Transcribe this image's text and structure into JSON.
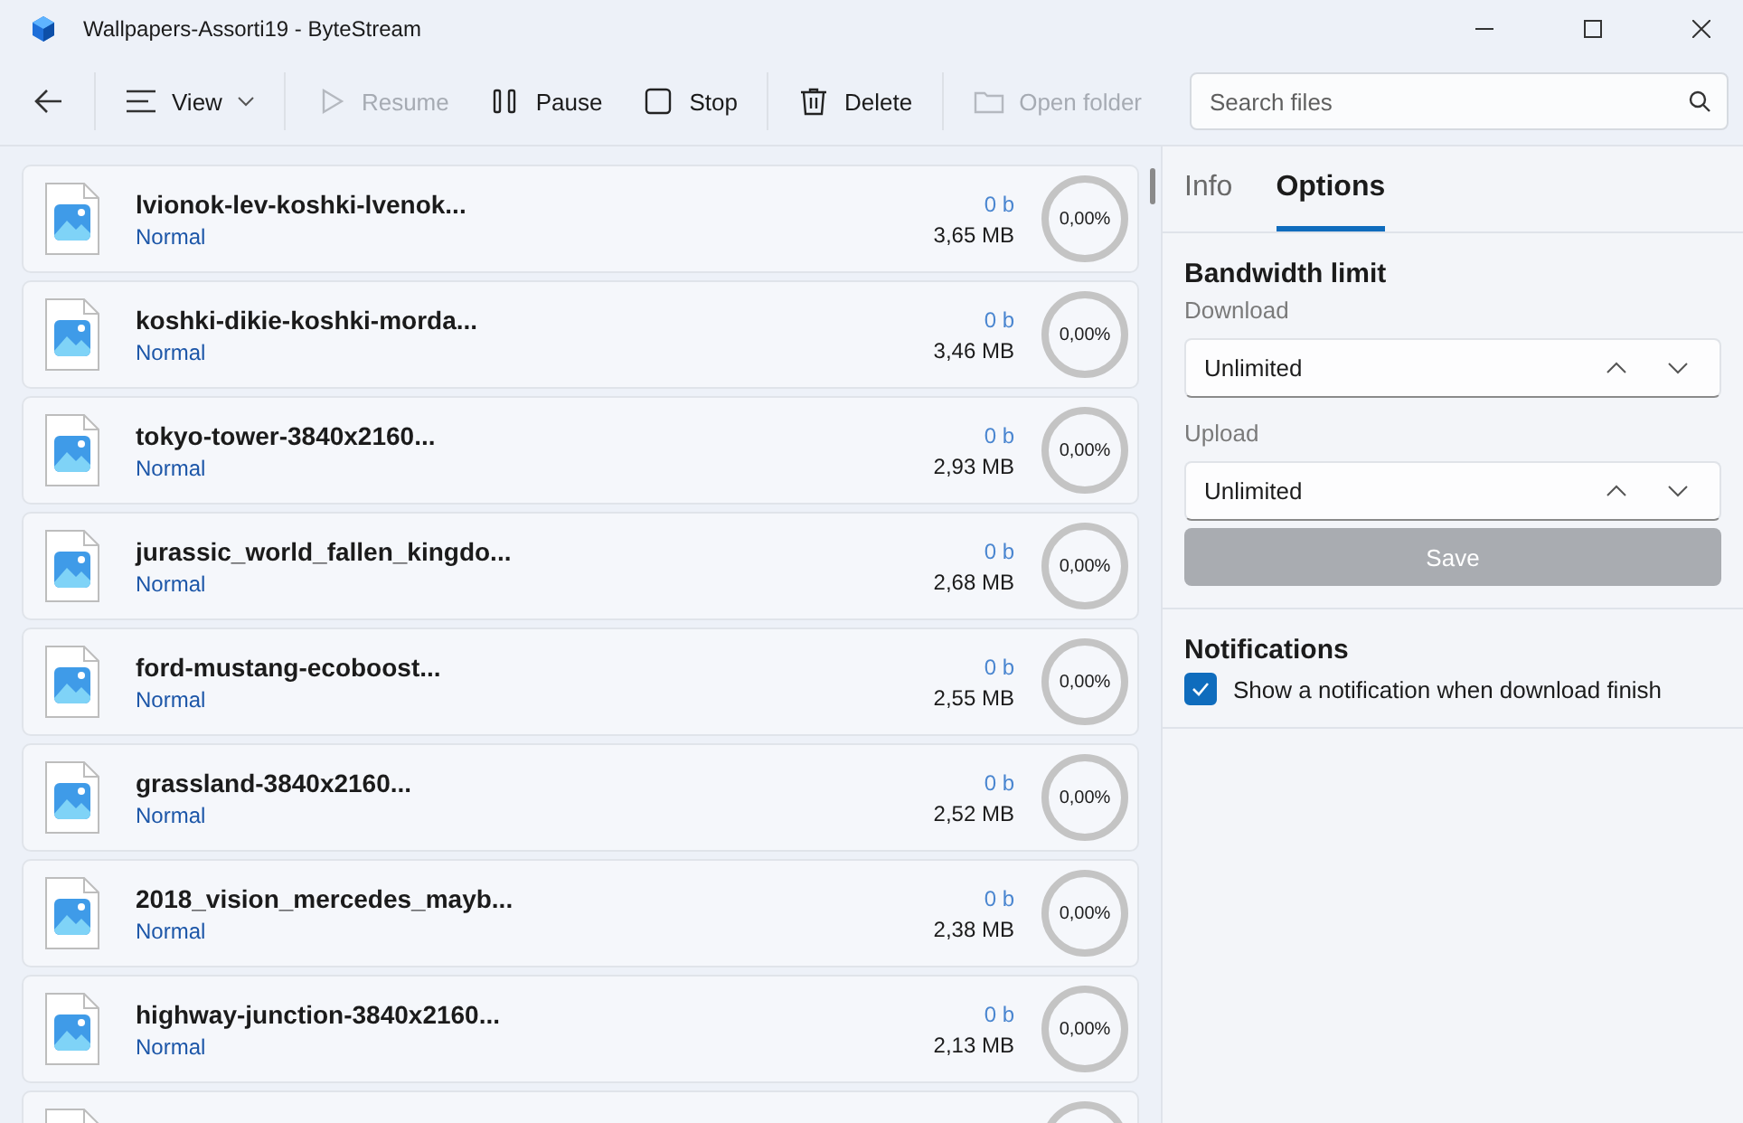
{
  "window": {
    "title": "Wallpapers-Assorti19 - ByteStream"
  },
  "toolbar": {
    "view_label": "View",
    "actions": [
      {
        "label": "Resume",
        "disabled": true
      },
      {
        "label": "Pause",
        "disabled": false
      },
      {
        "label": "Stop",
        "disabled": false
      },
      {
        "label": "Delete",
        "disabled": false
      },
      {
        "label": "Open folder",
        "disabled": true
      }
    ],
    "search": {
      "placeholder": "Search files"
    }
  },
  "downloads": [
    {
      "name": "lvionok-lev-koshki-lvenok...",
      "priority": "Normal",
      "downloaded": "0 b",
      "size": "3,65 MB",
      "percent": "0,00%"
    },
    {
      "name": "koshki-dikie-koshki-morda...",
      "priority": "Normal",
      "downloaded": "0 b",
      "size": "3,46 MB",
      "percent": "0,00%"
    },
    {
      "name": "tokyo-tower-3840x2160...",
      "priority": "Normal",
      "downloaded": "0 b",
      "size": "2,93 MB",
      "percent": "0,00%"
    },
    {
      "name": "jurassic_world_fallen_kingdo...",
      "priority": "Normal",
      "downloaded": "0 b",
      "size": "2,68 MB",
      "percent": "0,00%"
    },
    {
      "name": "ford-mustang-ecoboost...",
      "priority": "Normal",
      "downloaded": "0 b",
      "size": "2,55 MB",
      "percent": "0,00%"
    },
    {
      "name": "grassland-3840x2160...",
      "priority": "Normal",
      "downloaded": "0 b",
      "size": "2,52 MB",
      "percent": "0,00%"
    },
    {
      "name": "2018_vision_mercedes_mayb...",
      "priority": "Normal",
      "downloaded": "0 b",
      "size": "2,38 MB",
      "percent": "0,00%"
    },
    {
      "name": "highway-junction-3840x2160...",
      "priority": "Normal",
      "downloaded": "0 b",
      "size": "2,13 MB",
      "percent": "0,00%"
    }
  ],
  "panel": {
    "tabs": [
      {
        "label": "Info",
        "selected": false
      },
      {
        "label": "Options",
        "selected": true
      }
    ],
    "bandwidth": {
      "title": "Bandwidth limit",
      "fields": [
        {
          "label": "Download",
          "value": "Unlimited"
        },
        {
          "label": "Upload",
          "value": "Unlimited"
        }
      ],
      "save_label": "Save",
      "save_disabled": true
    },
    "notifications": {
      "title": "Notifications",
      "option": {
        "label": "Show a notification when download finish",
        "checked": true
      }
    }
  }
}
